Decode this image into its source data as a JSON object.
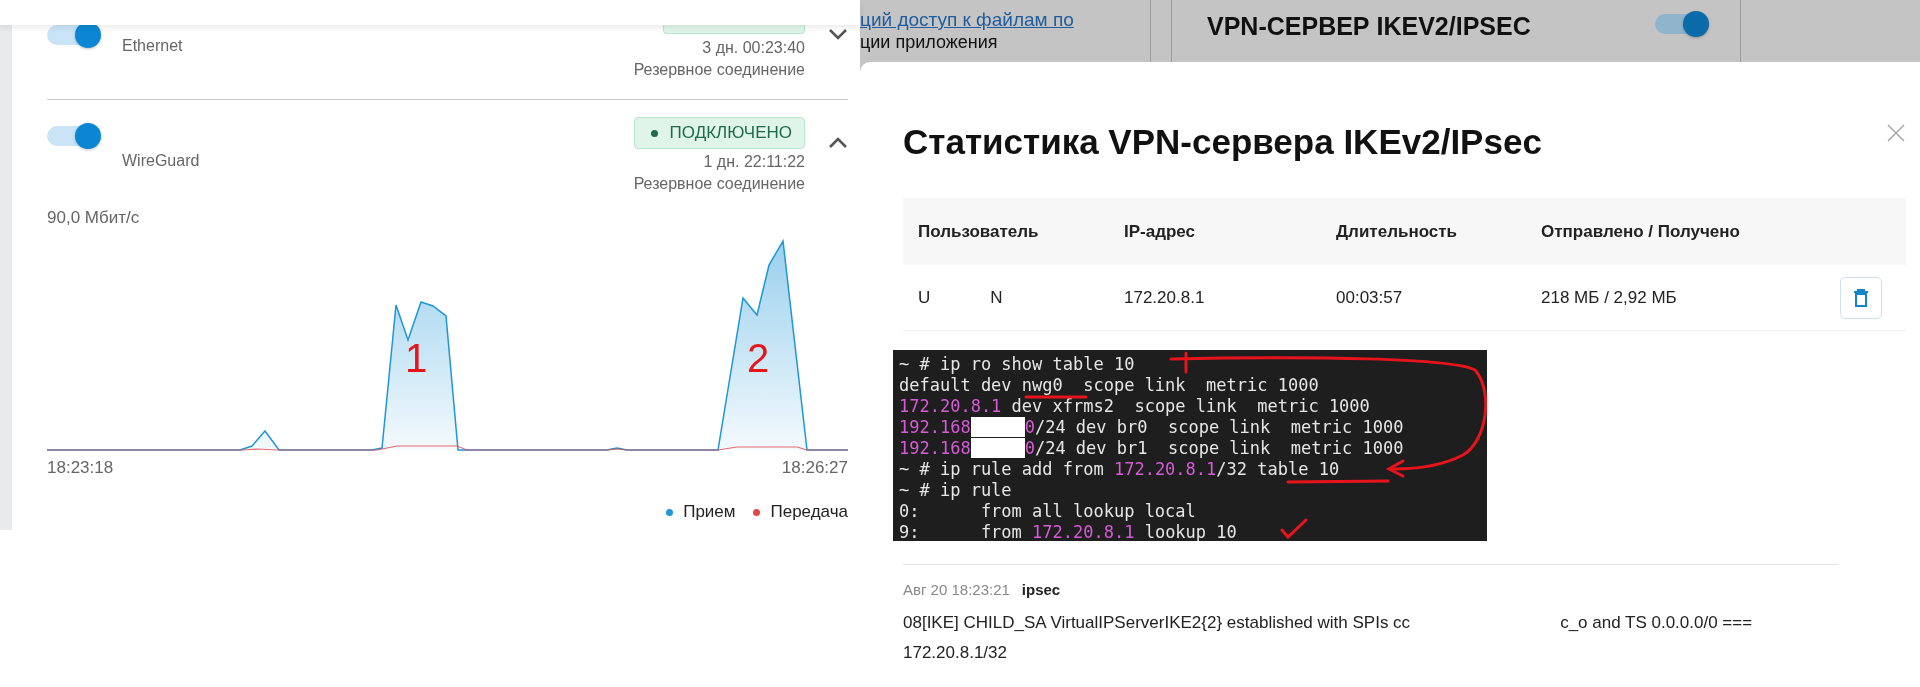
{
  "connections": [
    {
      "name": "Ethernet",
      "on": true,
      "expanded": false,
      "connected": true,
      "uptime": "3 дн. 00:23:40",
      "role": "Резервное соединение"
    },
    {
      "name": "WireGuard",
      "on": true,
      "expanded": true,
      "connected": true,
      "status_label": "ПОДКЛЮЧЕНО",
      "uptime": "1 дн. 22:11:22",
      "role": "Резервное соединение"
    }
  ],
  "traffic": {
    "max_label": "90,0 Мбит/с",
    "start_time": "18:23:18",
    "end_time": "18:26:27",
    "marks": [
      {
        "text": "1"
      },
      {
        "text": "2"
      }
    ],
    "legend": [
      {
        "label": "Прием",
        "color": "#1e96d8"
      },
      {
        "label": "Передача",
        "color": "#e04848"
      }
    ]
  },
  "background": {
    "link": "ций доступ к файлам по",
    "text": "ции приложения",
    "card_title": "VPN-СЕРВЕР IKEV2/IPSEC",
    "card_on": true
  },
  "modal": {
    "title": "Статистика VPN-сервера IKEv2/IPsec",
    "columns": [
      "Пользователь",
      "IP-адрес",
      "Длительность",
      "Отправлено / Получено"
    ],
    "rows": [
      {
        "user_parts": [
          "U",
          "N"
        ],
        "ip": "172.20.8.1",
        "duration": "00:03:57",
        "traffic": "218 МБ / 2,92 МБ"
      }
    ]
  },
  "terminal": [
    [
      {
        "kind": "text",
        "text": "~ # ip ro show table 10"
      }
    ],
    [
      {
        "kind": "text",
        "text": "default dev nwg0  scope link  metric 1000"
      }
    ],
    [
      {
        "kind": "ip",
        "text": "172.20.8.1"
      },
      {
        "kind": "text",
        "text": " dev xfrms2  scope link  metric 1000"
      }
    ],
    [
      {
        "kind": "ip",
        "text": "192.168"
      },
      {
        "kind": "redacted"
      },
      {
        "kind": "ip",
        "text": "0"
      },
      {
        "kind": "text",
        "text": "/24 dev br0  scope link  metric 1000"
      }
    ],
    [
      {
        "kind": "ip",
        "text": "192.168"
      },
      {
        "kind": "redacted"
      },
      {
        "kind": "ip",
        "text": "0"
      },
      {
        "kind": "text",
        "text": "/24 dev br1  scope link  metric 1000"
      }
    ],
    [
      {
        "kind": "text",
        "text": "~ # ip rule add from "
      },
      {
        "kind": "ip",
        "text": "172.20.8.1"
      },
      {
        "kind": "text",
        "text": "/32 table 10"
      }
    ],
    [
      {
        "kind": "text",
        "text": "~ # ip rule"
      }
    ],
    [
      {
        "kind": "text",
        "text": "0:      from all lookup local"
      }
    ],
    [
      {
        "kind": "text",
        "text": "9:      from "
      },
      {
        "kind": "ip",
        "text": "172.20.8.1"
      },
      {
        "kind": "text",
        "text": " lookup 10"
      }
    ]
  ],
  "log": {
    "time": "Авг 20 18:23:21",
    "source": "ipsec",
    "message_parts": [
      "08[IKE] CHILD_SA VirtualIPServerIKE2{2} established with SPIs cc",
      "c_o and TS 0.0.0.0/0 ==="
    ],
    "message_end": "172.20.8.1/32"
  }
}
